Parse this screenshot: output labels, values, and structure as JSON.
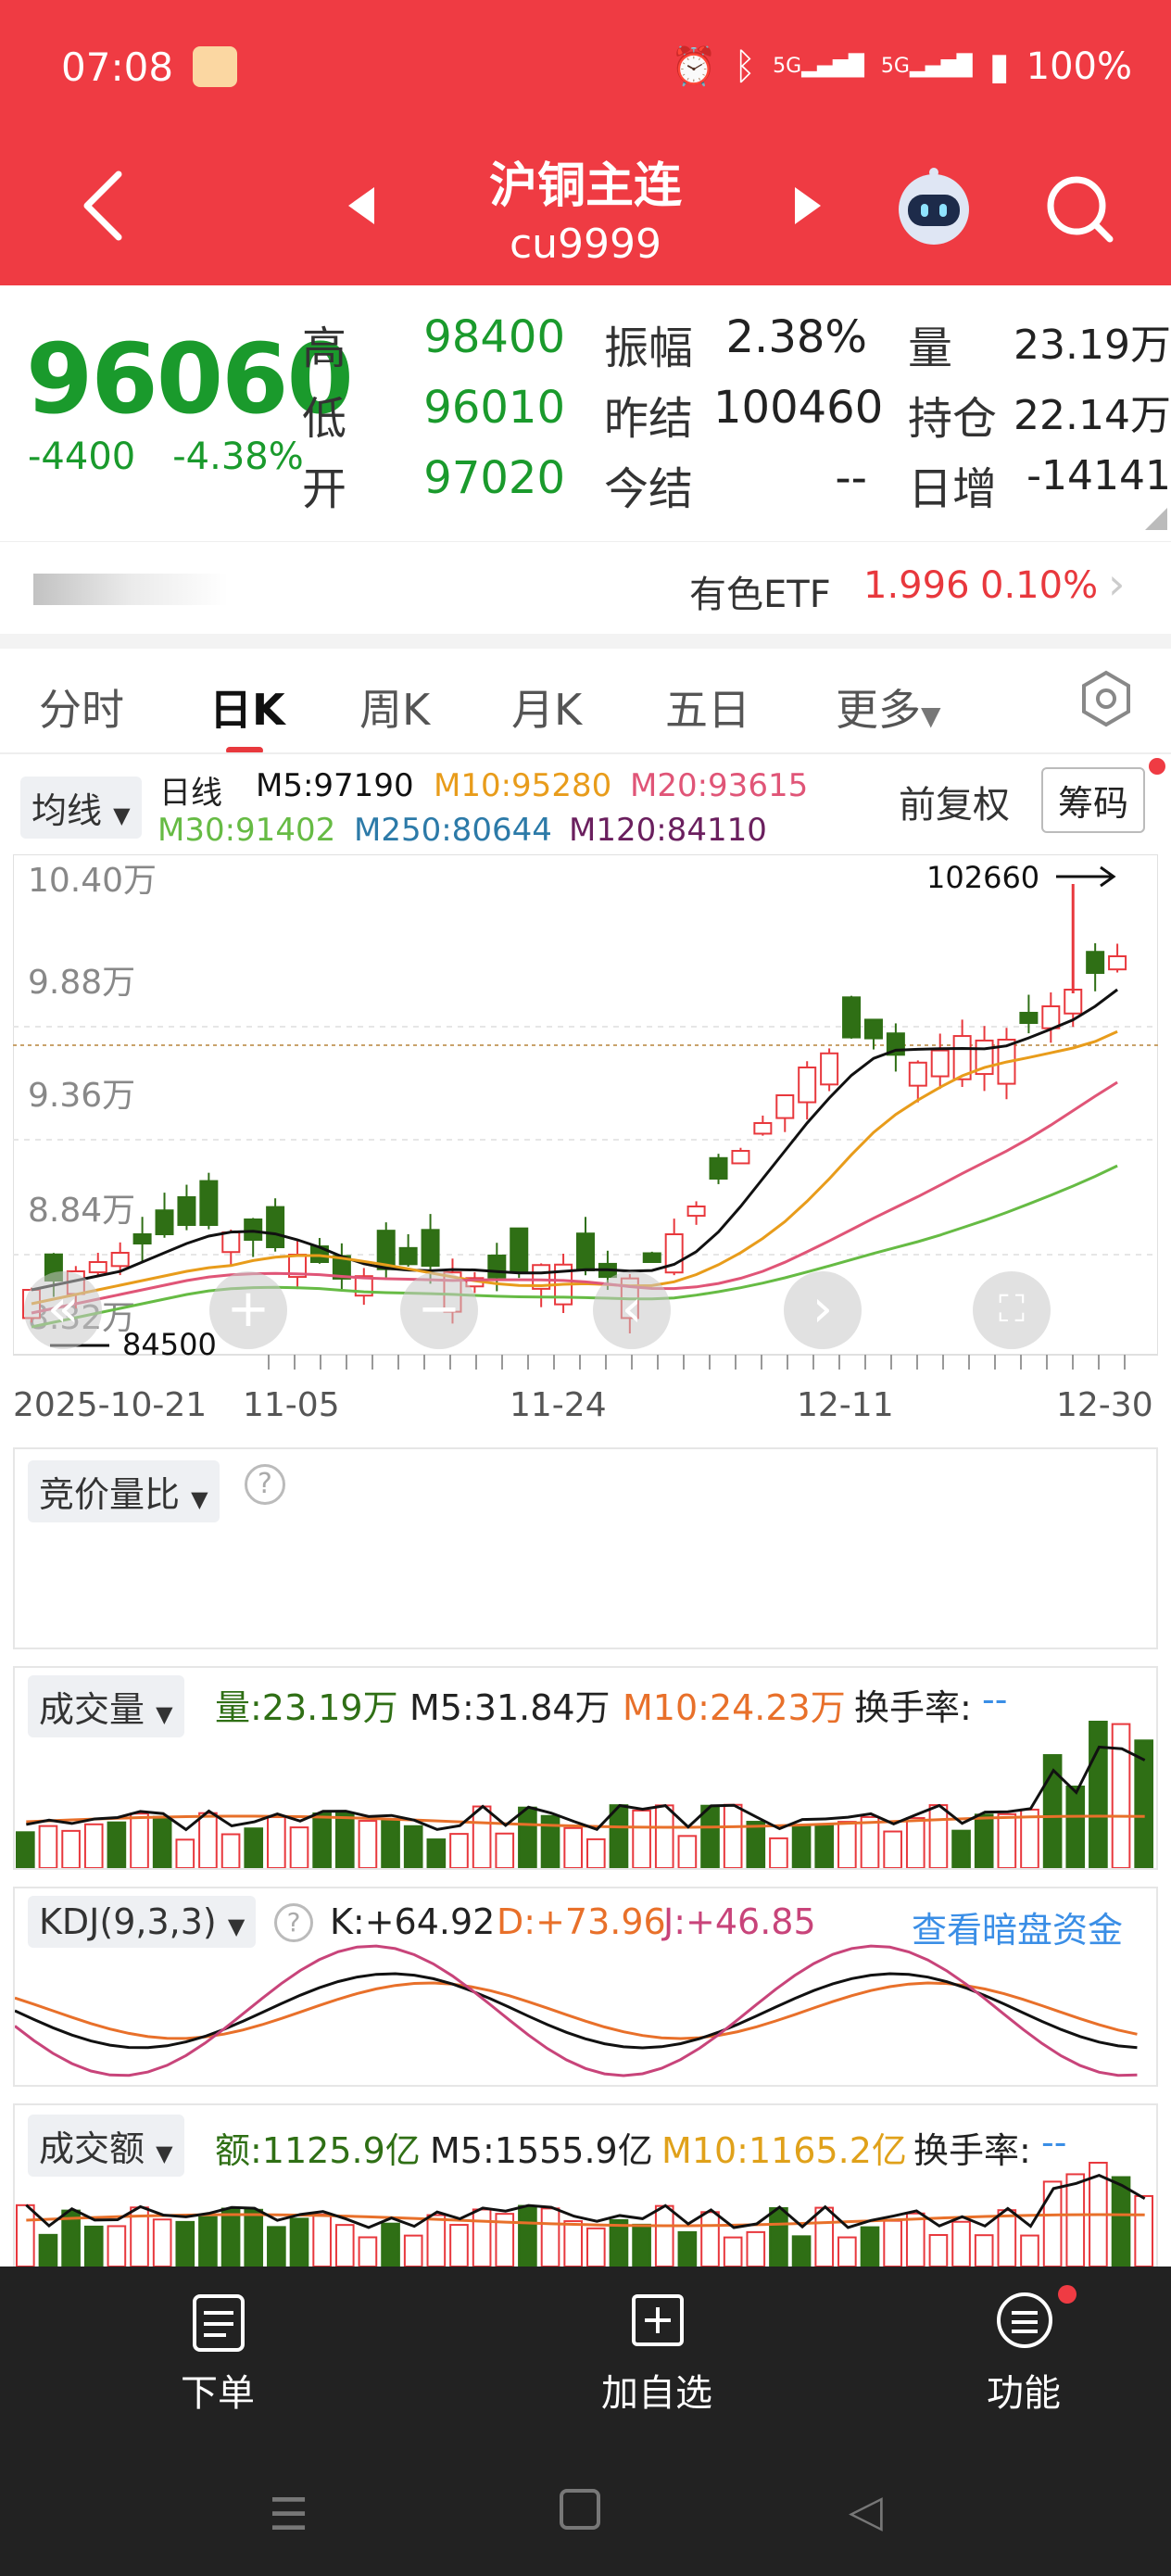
{
  "status": {
    "time": "07:08",
    "signal_5g_1": "5G",
    "signal_5g_2": "5G",
    "battery": "100%"
  },
  "header": {
    "title": "沪铜主连",
    "code": "cu9999"
  },
  "quote": {
    "price": "96060",
    "change": "-4400",
    "change_pct": "-4.38%",
    "high_label": "高",
    "high": "98400",
    "low_label": "低",
    "low": "96010",
    "open_label": "开",
    "open": "97020",
    "amp_label": "振幅",
    "amp": "2.38%",
    "prev_settle_label": "昨结",
    "prev_settle": "100460",
    "settle_label": "今结",
    "settle": "--",
    "vol_label": "量",
    "vol": "23.19万",
    "oi_label": "持仓",
    "oi": "22.14万",
    "daily_inc_label": "日增",
    "daily_inc": "-14141"
  },
  "etf": {
    "label": "有色ETF",
    "price": "1.996",
    "pct": "0.10%"
  },
  "tabs": [
    "分时",
    "日K",
    "周K",
    "月K",
    "五日",
    "更多"
  ],
  "kline": {
    "ma_selector": "均线",
    "period": "日线",
    "m5": "M5:97190",
    "m10": "M10:95280",
    "m20": "M20:93615",
    "m30": "M30:91402",
    "m250": "M250:80644",
    "m120": "M120:84110",
    "adjust": "前复权",
    "chips_button": "筹码",
    "y_labels": [
      "10.40万",
      "9.88万",
      "9.36万",
      "8.84万",
      "8.32万"
    ],
    "max_label": "102660",
    "min_label": "84500",
    "x_labels": [
      "2025-10-21",
      "11-05",
      "11-24",
      "12-11",
      "12-30"
    ]
  },
  "auction": {
    "label": "竞价量比"
  },
  "volume": {
    "selector": "成交量",
    "vol": "量:23.19万",
    "m5": "M5:31.84万",
    "m10": "M10:24.23万",
    "turnover_label": "换手率:",
    "turnover": "--"
  },
  "kdj": {
    "selector": "KDJ(9,3,3)",
    "k": "K:+64.92",
    "d": "D:+73.96",
    "j": "J:+46.85",
    "link": "查看暗盘资金"
  },
  "amount": {
    "selector": "成交额",
    "amt": "额:1125.9亿",
    "m5": "M5:1555.9亿",
    "m10": "M10:1165.2亿",
    "turnover_label": "换手率:",
    "turnover": "--"
  },
  "bottom": {
    "order": "下单",
    "add_watch": "加自选",
    "functions": "功能"
  },
  "colors": {
    "header": "#ef3b43",
    "up": "#e8383d",
    "down": "#2f6f15",
    "ma5": "#111111",
    "ma10": "#e89c1b",
    "ma20": "#e05577",
    "ma30": "#66bb44"
  }
}
